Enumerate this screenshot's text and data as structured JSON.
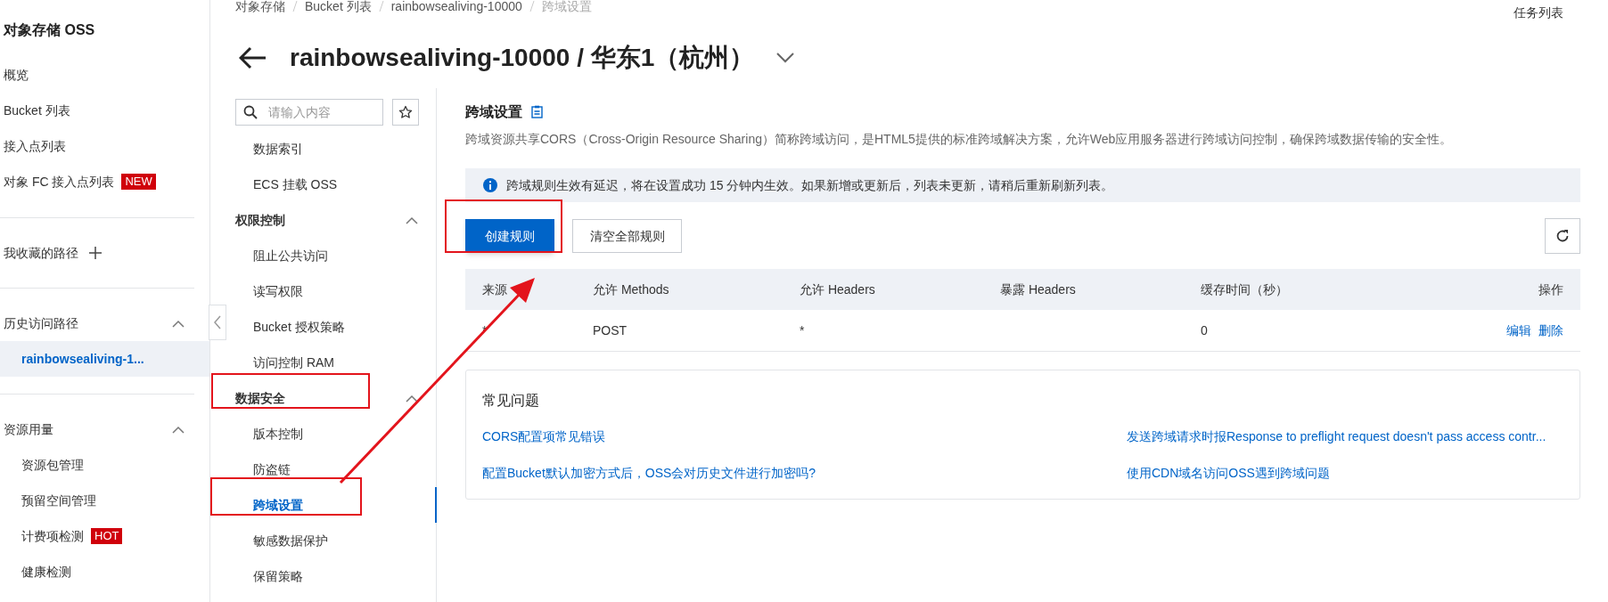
{
  "sidebar": {
    "title": "对象存储 OSS",
    "items": [
      {
        "label": "概览"
      },
      {
        "label": "Bucket 列表"
      },
      {
        "label": "接入点列表"
      },
      {
        "label": "对象 FC 接入点列表",
        "badge": "NEW"
      }
    ],
    "favorites": {
      "label": "我收藏的路径"
    },
    "history": {
      "label": "历史访问路径",
      "expanded": true,
      "items": [
        {
          "label": "rainbowsealiving-1...",
          "selected": true
        }
      ]
    },
    "usage": {
      "label": "资源用量",
      "expanded": true,
      "items": [
        {
          "label": "资源包管理"
        },
        {
          "label": "预留空间管理"
        },
        {
          "label": "计费项检测",
          "badge": "HOT"
        },
        {
          "label": "健康检测"
        }
      ]
    }
  },
  "breadcrumb": [
    "对象存储",
    "Bucket 列表",
    "rainbowsealiving-10000",
    "跨域设置"
  ],
  "task_list": "任务列表",
  "page_title": "rainbowsealiving-10000 / 华东1（杭州）",
  "subnav": {
    "search": {
      "placeholder": "请输入内容"
    },
    "items": [
      {
        "kind": "item",
        "label": "数据索引",
        "selected": false
      },
      {
        "kind": "item",
        "label": "ECS 挂载 OSS",
        "selected": false
      },
      {
        "kind": "group",
        "label": "权限控制",
        "expanded": true,
        "children": [
          {
            "label": "阻止公共访问",
            "selected": false
          },
          {
            "label": "读写权限",
            "selected": false
          },
          {
            "label": "Bucket 授权策略",
            "selected": false
          },
          {
            "label": "访问控制 RAM",
            "selected": false
          }
        ]
      },
      {
        "kind": "group",
        "label": "数据安全",
        "expanded": true,
        "children": [
          {
            "label": "版本控制",
            "selected": false
          },
          {
            "label": "防盗链",
            "selected": false
          },
          {
            "label": "跨域设置",
            "selected": true
          },
          {
            "label": "敏感数据保护",
            "selected": false
          },
          {
            "label": "保留策略",
            "selected": false
          }
        ]
      }
    ]
  },
  "section": {
    "title": "跨域设置",
    "description": "跨域资源共享CORS（Cross-Origin Resource Sharing）简称跨域访问，是HTML5提供的标准跨域解决方案，允许Web应用服务器进行跨域访问控制，确保跨域数据传输的安全性。",
    "notice": "跨域规则生效有延迟，将在设置成功 15 分钟内生效。如果新增或更新后，列表未更新，请稍后重新刷新列表。",
    "buttons": [
      {
        "label": "创建规则",
        "kind": "primary"
      },
      {
        "label": "清空全部规则",
        "kind": "secondary"
      }
    ]
  },
  "table": {
    "columns": [
      "来源",
      "允许 Methods",
      "允许 Headers",
      "暴露 Headers",
      "缓存时间（秒）",
      "操作"
    ],
    "rows": [
      {
        "cells": [
          "*",
          "POST",
          "*",
          "",
          "0"
        ],
        "actions": [
          "编辑",
          "删除"
        ]
      }
    ]
  },
  "faq": {
    "title": "常见问题",
    "links": [
      "CORS配置项常见错误",
      "发送跨域请求时报Response to preflight request doesn't pass access contr...",
      "配置Bucket默认加密方式后，OSS会对历史文件进行加密吗?",
      "使用CDN域名访问OSS遇到跨域问题"
    ]
  }
}
